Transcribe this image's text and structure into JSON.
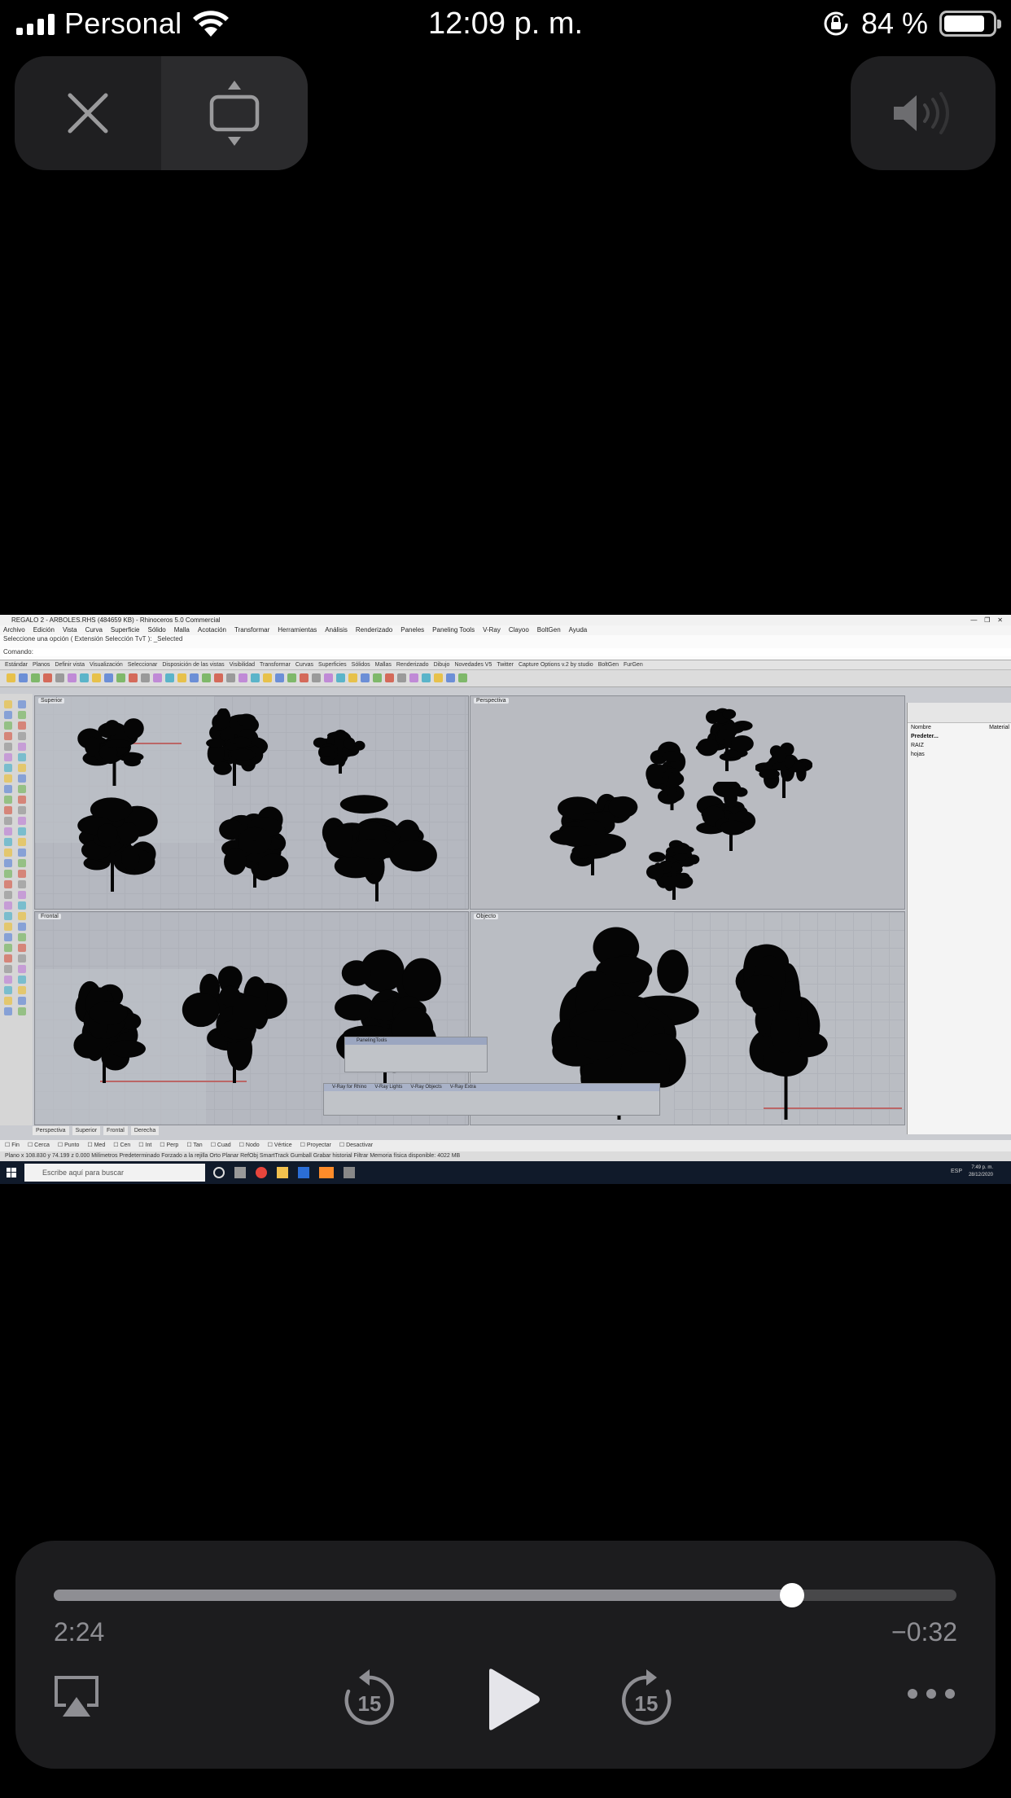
{
  "status_bar": {
    "carrier": "Personal",
    "time": "12:09 p. m.",
    "battery_percent": "84 %",
    "battery_level": 0.84,
    "icons": [
      "cellular-signal-icon",
      "wifi-icon",
      "orientation-lock-icon",
      "battery-icon"
    ]
  },
  "top_controls": {
    "close": "close-icon",
    "resize": "resize-pip-icon",
    "volume": "speaker-volume-icon"
  },
  "video": {
    "window_title": "REGALO 2 - ARBOLES.RHS (484659 KB) - Rhinoceros 5.0 Commercial",
    "menus": [
      "Archivo",
      "Edición",
      "Vista",
      "Curva",
      "Superficie",
      "Sólido",
      "Malla",
      "Acotación",
      "Transformar",
      "Herramientas",
      "Análisis",
      "Renderizado",
      "Paneles",
      "Paneling Tools",
      "V-Ray",
      "Clayoo",
      "BoltGen",
      "Ayuda"
    ],
    "command_history": "Seleccione una opción ( Extensión Selección TvT ): _Selected",
    "command_prompt": "Comando:",
    "toolbar_tabs": [
      "Estándar",
      "Planos",
      "Definir vista",
      "Visualización",
      "Seleccionar",
      "Disposición de las vistas",
      "Visibilidad",
      "Transformar",
      "Curvas",
      "Superficies",
      "Sólidos",
      "Mallas",
      "Renderizado",
      "Dibujo",
      "Novedades V5",
      "Twitter",
      "Capture Options v.2 by studio",
      "BoltGen",
      "FurGen"
    ],
    "viewports": [
      "Superior",
      "Perspectiva",
      "Frontal",
      "Objecto"
    ],
    "layers_panel": {
      "header": "Nombre",
      "header2": "Material",
      "rows": [
        "Predeter...",
        "RAIZ",
        "hojas"
      ]
    },
    "float_toolbars": [
      "PanelingTools",
      "V-Ray for Rhino",
      "V-Ray Lights",
      "V-Ray Objects",
      "V-Ray Extra"
    ],
    "view_tabs": [
      "Perspectiva",
      "Superior",
      "Frontal",
      "Derecha"
    ],
    "osnap_items": [
      "Fin",
      "Cerca",
      "Punto",
      "Med",
      "Cen",
      "Int",
      "Perp",
      "Tan",
      "Cuad",
      "Nodo",
      "Vértice",
      "Proyectar",
      "Desactivar"
    ],
    "status_row": "Plano  x 108.830  y 74.199  z 0.000  Milímetros  Predeterminado  Forzado a la rejilla  Orto  Planar  RefObj  SmartTrack  Gumball  Grabar historial  Filtrar  Memoria física disponible: 4022 MB",
    "taskbar_search": "Escribe aquí para buscar",
    "taskbar_time": "7:49 p. m.",
    "taskbar_date": "28/12/2020",
    "taskbar_lang": "ESP"
  },
  "player": {
    "progress": 0.8176,
    "elapsed": "2:24",
    "remaining": "−0:32",
    "skip_seconds": "15",
    "buttons": [
      "airplay-icon",
      "skip-back-15-icon",
      "play-icon",
      "skip-forward-15-icon",
      "more-options-icon"
    ]
  }
}
